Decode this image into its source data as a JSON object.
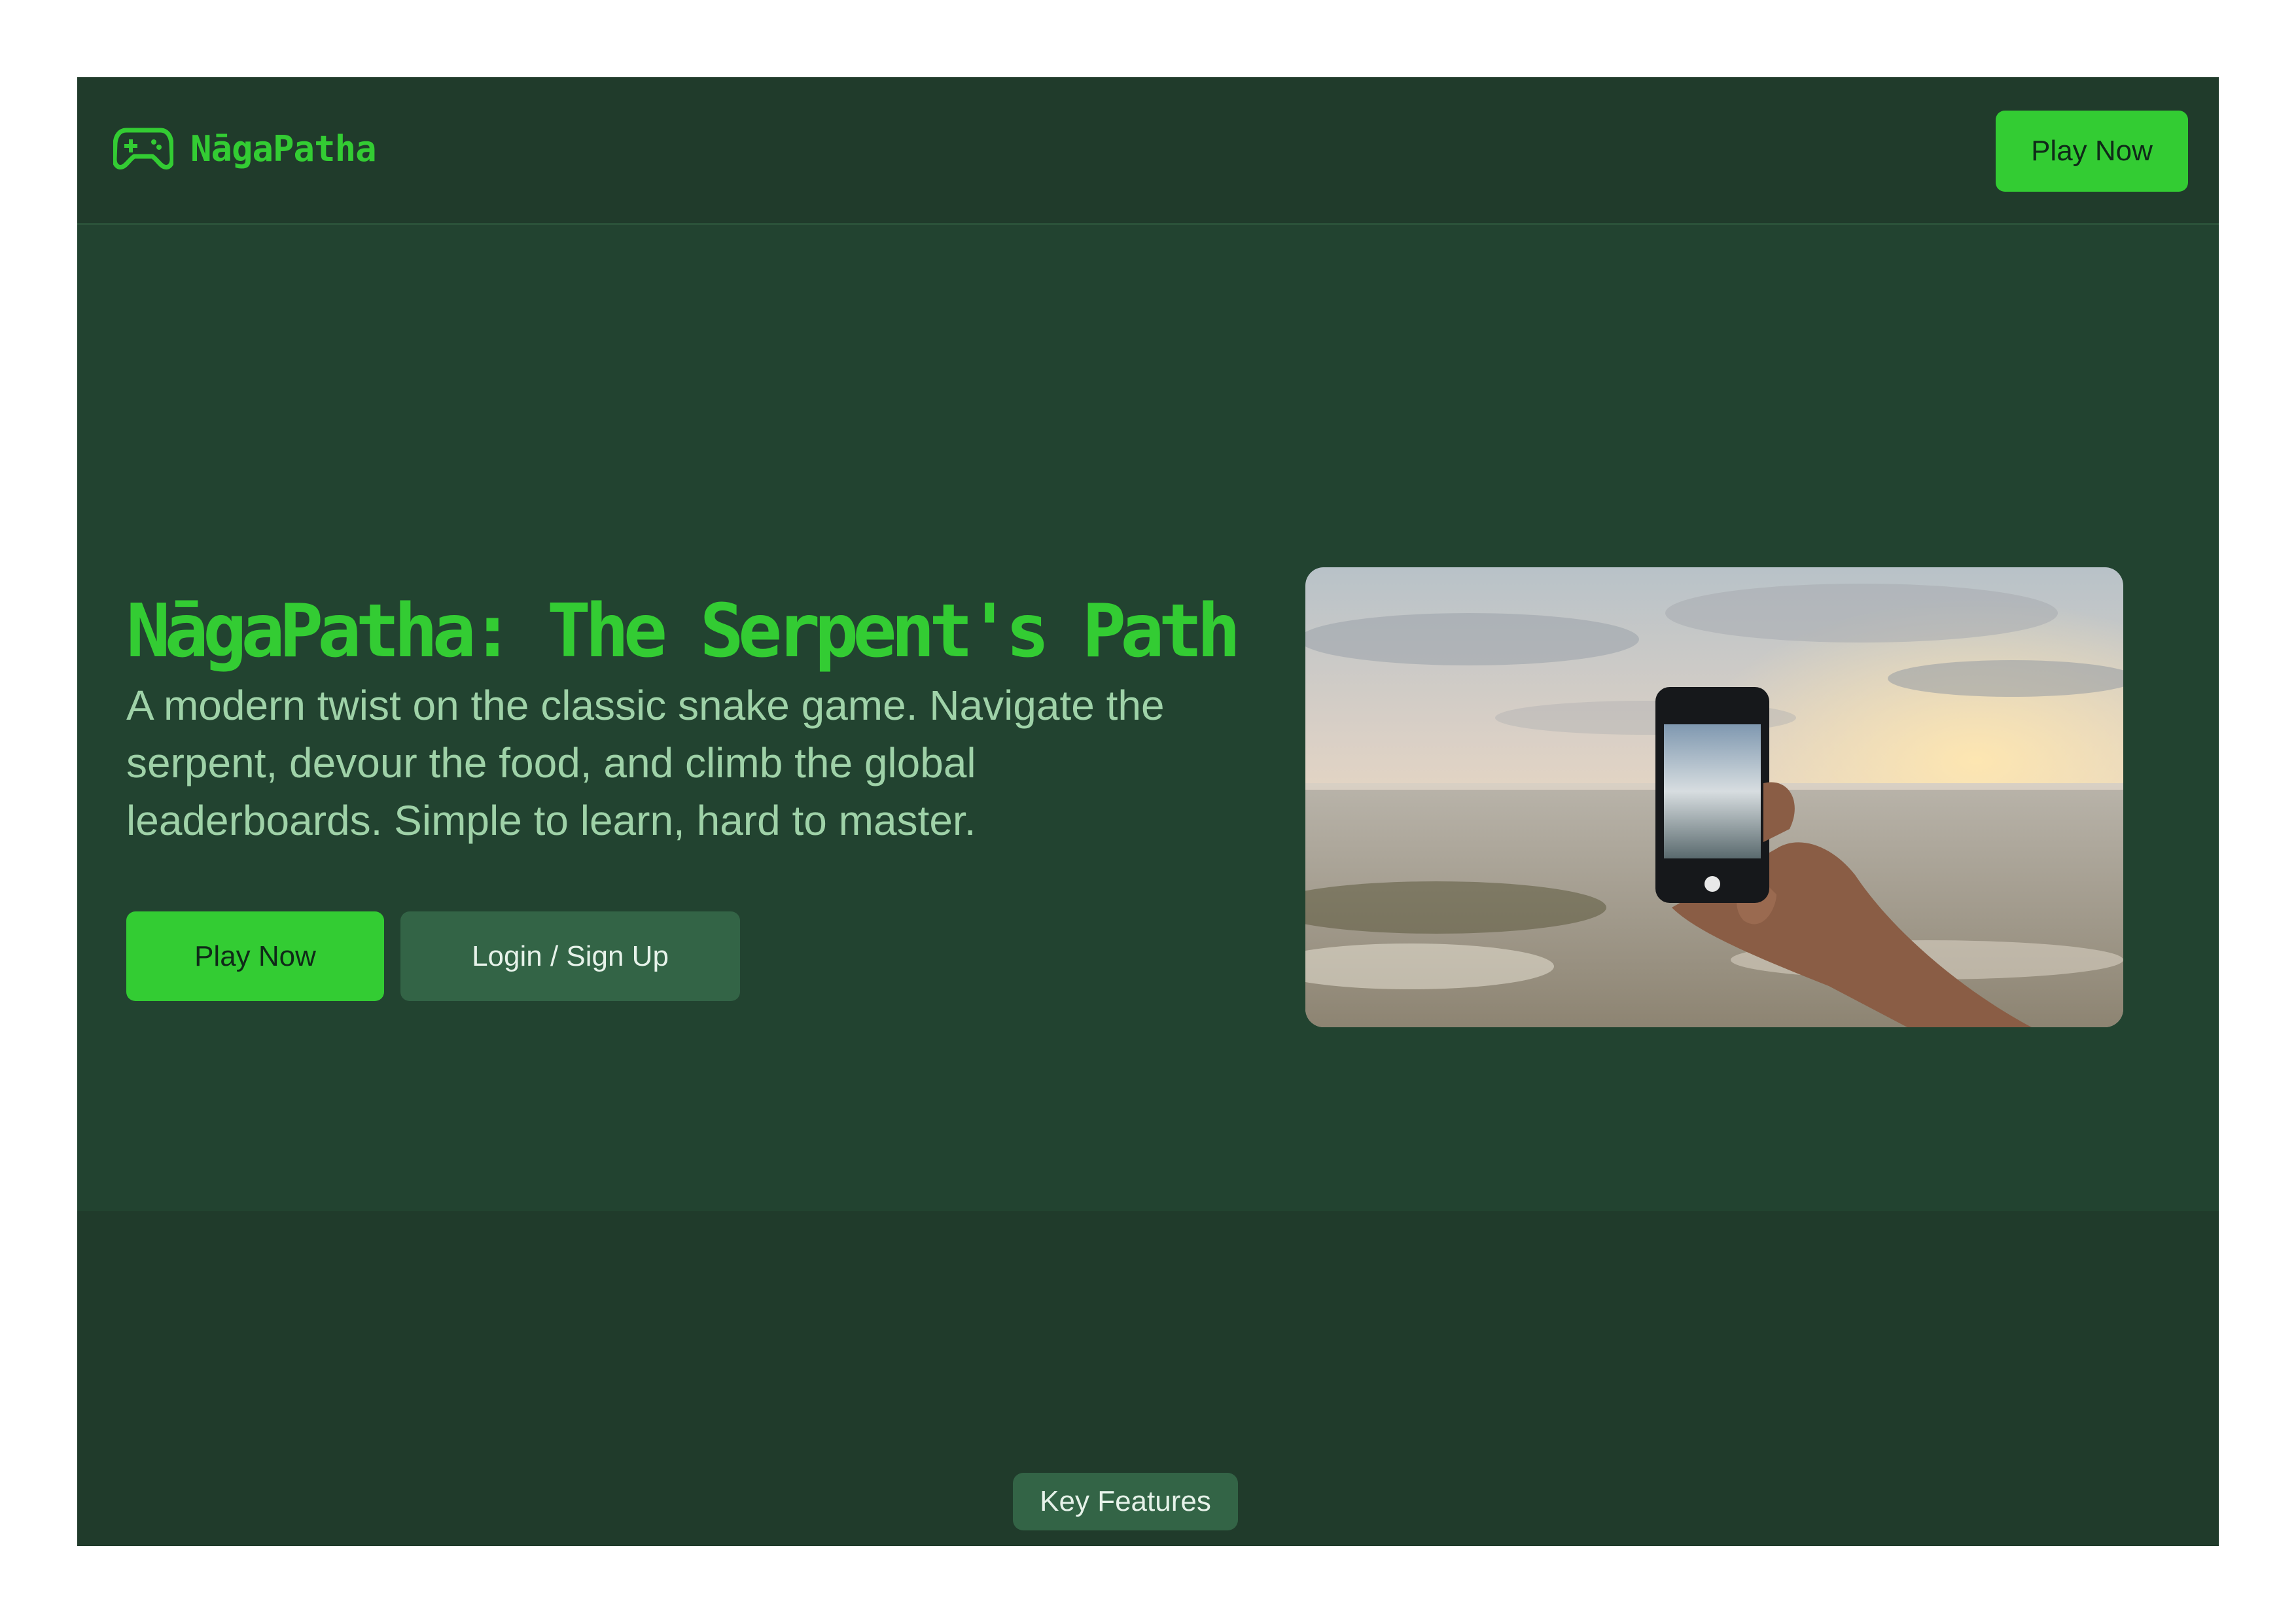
{
  "brand": {
    "name": "NāgaPatha",
    "icon": "gamepad-icon",
    "color": "#33cc33"
  },
  "header": {
    "cta_label": "Play Now"
  },
  "hero": {
    "title": "NāgaPatha: The Serpent's Path",
    "description": "A modern twist on the classic snake game. Navigate the serpent, devour the food, and climb the global leaderboards. Simple to learn, hard to master.",
    "play_label": "Play Now",
    "login_label": "Login / Sign Up"
  },
  "features": {
    "badge_label": "Key Features"
  },
  "colors": {
    "page_bg": "#224330",
    "header_bg": "#203b2b",
    "accent": "#33cc33",
    "secondary_button": "#336446",
    "description_text": "#9fd2a8"
  }
}
